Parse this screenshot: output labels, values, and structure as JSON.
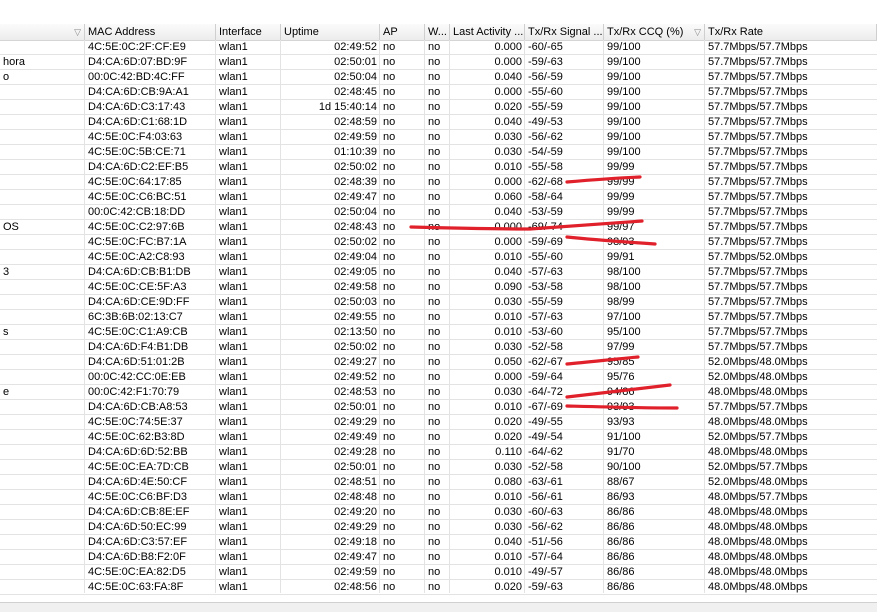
{
  "columns": [
    {
      "key": "name",
      "label": "",
      "sort": "▽"
    },
    {
      "key": "mac",
      "label": "MAC Address",
      "sort": ""
    },
    {
      "key": "iface",
      "label": "Interface",
      "sort": ""
    },
    {
      "key": "uptime",
      "label": "Uptime",
      "sort": ""
    },
    {
      "key": "ap",
      "label": "AP",
      "sort": ""
    },
    {
      "key": "w",
      "label": "W...",
      "sort": ""
    },
    {
      "key": "last",
      "label": "Last Activity ...",
      "sort": ""
    },
    {
      "key": "sig",
      "label": "Tx/Rx Signal ...",
      "sort": ""
    },
    {
      "key": "ccq",
      "label": "Tx/Rx CCQ (%)",
      "sort": "▽"
    },
    {
      "key": "rate",
      "label": "Tx/Rx Rate",
      "sort": ""
    }
  ],
  "rows": [
    {
      "name": "",
      "mac": "4C:5E:0C:2F:CF:E9",
      "iface": "wlan1",
      "uptime": "02:49:52",
      "ap": "no",
      "w": "no",
      "last": "0.000",
      "sig": "-60/-65",
      "ccq": "99/100",
      "rate": "57.7Mbps/57.7Mbps"
    },
    {
      "name": "hora",
      "mac": "D4:CA:6D:07:BD:9F",
      "iface": "wlan1",
      "uptime": "02:50:01",
      "ap": "no",
      "w": "no",
      "last": "0.000",
      "sig": "-59/-63",
      "ccq": "99/100",
      "rate": "57.7Mbps/57.7Mbps"
    },
    {
      "name": "o",
      "mac": "00:0C:42:BD:4C:FF",
      "iface": "wlan1",
      "uptime": "02:50:04",
      "ap": "no",
      "w": "no",
      "last": "0.040",
      "sig": "-56/-59",
      "ccq": "99/100",
      "rate": "57.7Mbps/57.7Mbps"
    },
    {
      "name": "",
      "mac": "D4:CA:6D:CB:9A:A1",
      "iface": "wlan1",
      "uptime": "02:48:45",
      "ap": "no",
      "w": "no",
      "last": "0.000",
      "sig": "-55/-60",
      "ccq": "99/100",
      "rate": "57.7Mbps/57.7Mbps"
    },
    {
      "name": "",
      "mac": "D4:CA:6D:C3:17:43",
      "iface": "wlan1",
      "uptime": "1d 15:40:14",
      "ap": "no",
      "w": "no",
      "last": "0.020",
      "sig": "-55/-59",
      "ccq": "99/100",
      "rate": "57.7Mbps/57.7Mbps"
    },
    {
      "name": "",
      "mac": "D4:CA:6D:C1:68:1D",
      "iface": "wlan1",
      "uptime": "02:48:59",
      "ap": "no",
      "w": "no",
      "last": "0.040",
      "sig": "-49/-53",
      "ccq": "99/100",
      "rate": "57.7Mbps/57.7Mbps"
    },
    {
      "name": "",
      "mac": "4C:5E:0C:F4:03:63",
      "iface": "wlan1",
      "uptime": "02:49:59",
      "ap": "no",
      "w": "no",
      "last": "0.030",
      "sig": "-56/-62",
      "ccq": "99/100",
      "rate": "57.7Mbps/57.7Mbps"
    },
    {
      "name": "",
      "mac": "4C:5E:0C:5B:CE:71",
      "iface": "wlan1",
      "uptime": "01:10:39",
      "ap": "no",
      "w": "no",
      "last": "0.030",
      "sig": "-54/-59",
      "ccq": "99/100",
      "rate": "57.7Mbps/57.7Mbps"
    },
    {
      "name": "",
      "mac": "D4:CA:6D:C2:EF:B5",
      "iface": "wlan1",
      "uptime": "02:50:02",
      "ap": "no",
      "w": "no",
      "last": "0.010",
      "sig": "-55/-58",
      "ccq": "99/99",
      "rate": "57.7Mbps/57.7Mbps"
    },
    {
      "name": "",
      "mac": "4C:5E:0C:64:17:85",
      "iface": "wlan1",
      "uptime": "02:48:39",
      "ap": "no",
      "w": "no",
      "last": "0.000",
      "sig": "-62/-68",
      "ccq": "99/99",
      "rate": "57.7Mbps/57.7Mbps"
    },
    {
      "name": "",
      "mac": "4C:5E:0C:C6:BC:51",
      "iface": "wlan1",
      "uptime": "02:49:47",
      "ap": "no",
      "w": "no",
      "last": "0.060",
      "sig": "-58/-64",
      "ccq": "99/99",
      "rate": "57.7Mbps/57.7Mbps"
    },
    {
      "name": "",
      "mac": "00:0C:42:CB:18:DD",
      "iface": "wlan1",
      "uptime": "02:50:04",
      "ap": "no",
      "w": "no",
      "last": "0.040",
      "sig": "-53/-59",
      "ccq": "99/99",
      "rate": "57.7Mbps/57.7Mbps"
    },
    {
      "name": "OS",
      "mac": "4C:5E:0C:C2:97:6B",
      "iface": "wlan1",
      "uptime": "02:48:43",
      "ap": "no",
      "w": "no",
      "last": "0.000",
      "sig": "-69/-74",
      "ccq": "99/97",
      "rate": "57.7Mbps/57.7Mbps"
    },
    {
      "name": "",
      "mac": "4C:5E:0C:FC:B7:1A",
      "iface": "wlan1",
      "uptime": "02:50:02",
      "ap": "no",
      "w": "no",
      "last": "0.000",
      "sig": "-59/-69",
      "ccq": "98/93",
      "rate": "57.7Mbps/57.7Mbps"
    },
    {
      "name": "",
      "mac": "4C:5E:0C:A2:C8:93",
      "iface": "wlan1",
      "uptime": "02:49:04",
      "ap": "no",
      "w": "no",
      "last": "0.010",
      "sig": "-55/-60",
      "ccq": "99/91",
      "rate": "57.7Mbps/52.0Mbps"
    },
    {
      "name": "3",
      "mac": "D4:CA:6D:CB:B1:DB",
      "iface": "wlan1",
      "uptime": "02:49:05",
      "ap": "no",
      "w": "no",
      "last": "0.040",
      "sig": "-57/-63",
      "ccq": "98/100",
      "rate": "57.7Mbps/57.7Mbps"
    },
    {
      "name": "",
      "mac": "4C:5E:0C:CE:5F:A3",
      "iface": "wlan1",
      "uptime": "02:49:58",
      "ap": "no",
      "w": "no",
      "last": "0.090",
      "sig": "-53/-58",
      "ccq": "98/100",
      "rate": "57.7Mbps/57.7Mbps"
    },
    {
      "name": "",
      "mac": "D4:CA:6D:CE:9D:FF",
      "iface": "wlan1",
      "uptime": "02:50:03",
      "ap": "no",
      "w": "no",
      "last": "0.030",
      "sig": "-55/-59",
      "ccq": "98/99",
      "rate": "57.7Mbps/57.7Mbps"
    },
    {
      "name": "",
      "mac": "6C:3B:6B:02:13:C7",
      "iface": "wlan1",
      "uptime": "02:49:55",
      "ap": "no",
      "w": "no",
      "last": "0.010",
      "sig": "-57/-63",
      "ccq": "97/100",
      "rate": "57.7Mbps/57.7Mbps"
    },
    {
      "name": "s",
      "mac": "4C:5E:0C:C1:A9:CB",
      "iface": "wlan1",
      "uptime": "02:13:50",
      "ap": "no",
      "w": "no",
      "last": "0.010",
      "sig": "-53/-60",
      "ccq": "95/100",
      "rate": "57.7Mbps/57.7Mbps"
    },
    {
      "name": "",
      "mac": "D4:CA:6D:F4:B1:DB",
      "iface": "wlan1",
      "uptime": "02:50:02",
      "ap": "no",
      "w": "no",
      "last": "0.030",
      "sig": "-52/-58",
      "ccq": "97/99",
      "rate": "57.7Mbps/57.7Mbps"
    },
    {
      "name": "",
      "mac": "D4:CA:6D:51:01:2B",
      "iface": "wlan1",
      "uptime": "02:49:27",
      "ap": "no",
      "w": "no",
      "last": "0.050",
      "sig": "-62/-67",
      "ccq": "95/85",
      "rate": "52.0Mbps/48.0Mbps"
    },
    {
      "name": "",
      "mac": "00:0C:42:CC:0E:EB",
      "iface": "wlan1",
      "uptime": "02:49:52",
      "ap": "no",
      "w": "no",
      "last": "0.000",
      "sig": "-59/-64",
      "ccq": "95/76",
      "rate": "52.0Mbps/48.0Mbps"
    },
    {
      "name": "e",
      "mac": "00:0C:42:F1:70:79",
      "iface": "wlan1",
      "uptime": "02:48:53",
      "ap": "no",
      "w": "no",
      "last": "0.030",
      "sig": "-64/-72",
      "ccq": "94/86",
      "rate": "48.0Mbps/48.0Mbps"
    },
    {
      "name": "",
      "mac": "D4:CA:6D:CB:A8:53",
      "iface": "wlan1",
      "uptime": "02:50:01",
      "ap": "no",
      "w": "no",
      "last": "0.010",
      "sig": "-67/-69",
      "ccq": "93/93",
      "rate": "57.7Mbps/57.7Mbps"
    },
    {
      "name": "",
      "mac": "4C:5E:0C:74:5E:37",
      "iface": "wlan1",
      "uptime": "02:49:29",
      "ap": "no",
      "w": "no",
      "last": "0.020",
      "sig": "-49/-55",
      "ccq": "93/93",
      "rate": "48.0Mbps/48.0Mbps"
    },
    {
      "name": "",
      "mac": "4C:5E:0C:62:B3:8D",
      "iface": "wlan1",
      "uptime": "02:49:49",
      "ap": "no",
      "w": "no",
      "last": "0.020",
      "sig": "-49/-54",
      "ccq": "91/100",
      "rate": "52.0Mbps/57.7Mbps"
    },
    {
      "name": "",
      "mac": "D4:CA:6D:6D:52:BB",
      "iface": "wlan1",
      "uptime": "02:49:28",
      "ap": "no",
      "w": "no",
      "last": "0.110",
      "sig": "-64/-62",
      "ccq": "91/70",
      "rate": "48.0Mbps/48.0Mbps"
    },
    {
      "name": "",
      "mac": "4C:5E:0C:EA:7D:CB",
      "iface": "wlan1",
      "uptime": "02:50:01",
      "ap": "no",
      "w": "no",
      "last": "0.030",
      "sig": "-52/-58",
      "ccq": "90/100",
      "rate": "52.0Mbps/57.7Mbps"
    },
    {
      "name": "",
      "mac": "D4:CA:6D:4E:50:CF",
      "iface": "wlan1",
      "uptime": "02:48:51",
      "ap": "no",
      "w": "no",
      "last": "0.080",
      "sig": "-63/-61",
      "ccq": "88/67",
      "rate": "52.0Mbps/48.0Mbps"
    },
    {
      "name": "",
      "mac": "4C:5E:0C:C6:BF:D3",
      "iface": "wlan1",
      "uptime": "02:48:48",
      "ap": "no",
      "w": "no",
      "last": "0.010",
      "sig": "-56/-61",
      "ccq": "86/93",
      "rate": "48.0Mbps/57.7Mbps"
    },
    {
      "name": "",
      "mac": "D4:CA:6D:CB:8E:EF",
      "iface": "wlan1",
      "uptime": "02:49:20",
      "ap": "no",
      "w": "no",
      "last": "0.030",
      "sig": "-60/-63",
      "ccq": "86/86",
      "rate": "48.0Mbps/48.0Mbps"
    },
    {
      "name": "",
      "mac": "D4:CA:6D:50:EC:99",
      "iface": "wlan1",
      "uptime": "02:49:29",
      "ap": "no",
      "w": "no",
      "last": "0.030",
      "sig": "-56/-62",
      "ccq": "86/86",
      "rate": "48.0Mbps/48.0Mbps"
    },
    {
      "name": "",
      "mac": "D4:CA:6D:C3:57:EF",
      "iface": "wlan1",
      "uptime": "02:49:18",
      "ap": "no",
      "w": "no",
      "last": "0.040",
      "sig": "-51/-56",
      "ccq": "86/86",
      "rate": "48.0Mbps/48.0Mbps"
    },
    {
      "name": "",
      "mac": "D4:CA:6D:B8:F2:0F",
      "iface": "wlan1",
      "uptime": "02:49:47",
      "ap": "no",
      "w": "no",
      "last": "0.010",
      "sig": "-57/-64",
      "ccq": "86/86",
      "rate": "48.0Mbps/48.0Mbps"
    },
    {
      "name": "",
      "mac": "4C:5E:0C:EA:82:D5",
      "iface": "wlan1",
      "uptime": "02:49:59",
      "ap": "no",
      "w": "no",
      "last": "0.010",
      "sig": "-49/-57",
      "ccq": "86/86",
      "rate": "48.0Mbps/48.0Mbps"
    },
    {
      "name": "",
      "mac": "4C:5E:0C:63:FA:8F",
      "iface": "wlan1",
      "uptime": "02:48:56",
      "ap": "no",
      "w": "no",
      "last": "0.020",
      "sig": "-59/-63",
      "ccq": "86/86",
      "rate": "48.0Mbps/48.0Mbps"
    }
  ],
  "annotation_color": "#e0202a"
}
